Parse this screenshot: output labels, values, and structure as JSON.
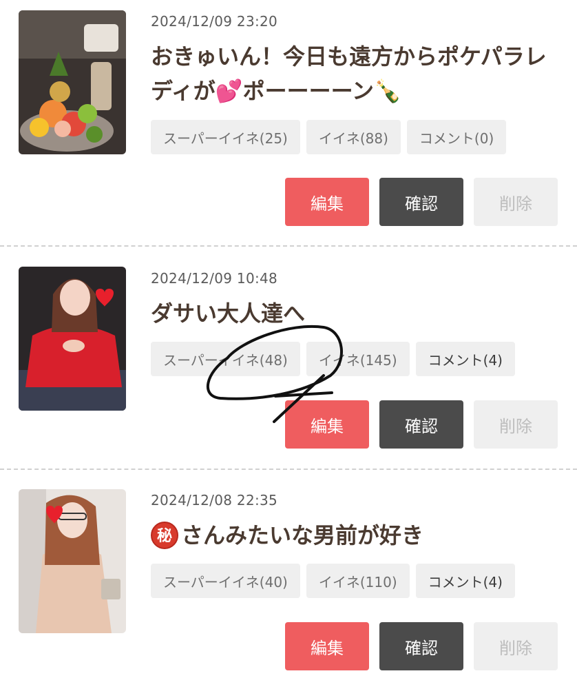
{
  "posts": [
    {
      "date": "2024/12/09 23:20",
      "title_text": "おきゅいん！今日も遠方からポケパラレディが",
      "title_emoji": "💕",
      "title_text2": "ポーーーーン",
      "title_emoji2": "🍾",
      "stats": {
        "super_like": "スーパーイイネ(25)",
        "like": "イイネ(88)",
        "comment": "コメント(0)"
      },
      "buttons": {
        "edit": "編集",
        "confirm": "確認",
        "delete": "削除"
      }
    },
    {
      "date": "2024/12/09 10:48",
      "title_text": "ダサい大人達へ",
      "stats": {
        "super_like": "スーパーイイネ(48)",
        "like": "イイネ(145)",
        "comment": "コメント(4)"
      },
      "buttons": {
        "edit": "編集",
        "confirm": "確認",
        "delete": "削除"
      }
    },
    {
      "date": "2024/12/08 22:35",
      "title_badge": "秘",
      "title_text": "さんみたいな男前が好き",
      "stats": {
        "super_like": "スーパーイイネ(40)",
        "like": "イイネ(110)",
        "comment": "コメント(4)"
      },
      "buttons": {
        "edit": "編集",
        "confirm": "確認",
        "delete": "削除"
      }
    }
  ],
  "colors": {
    "edit_button": "#ef5d5f",
    "confirm_button": "#4b4b4b",
    "delete_button": "#efefef",
    "stat_chip": "#efefef",
    "title_text": "#4a3a30"
  },
  "icons": [
    "two-hearts-emoji",
    "champagne-emoji",
    "secret-ideograph-badge",
    "heart-sticker-icon"
  ]
}
